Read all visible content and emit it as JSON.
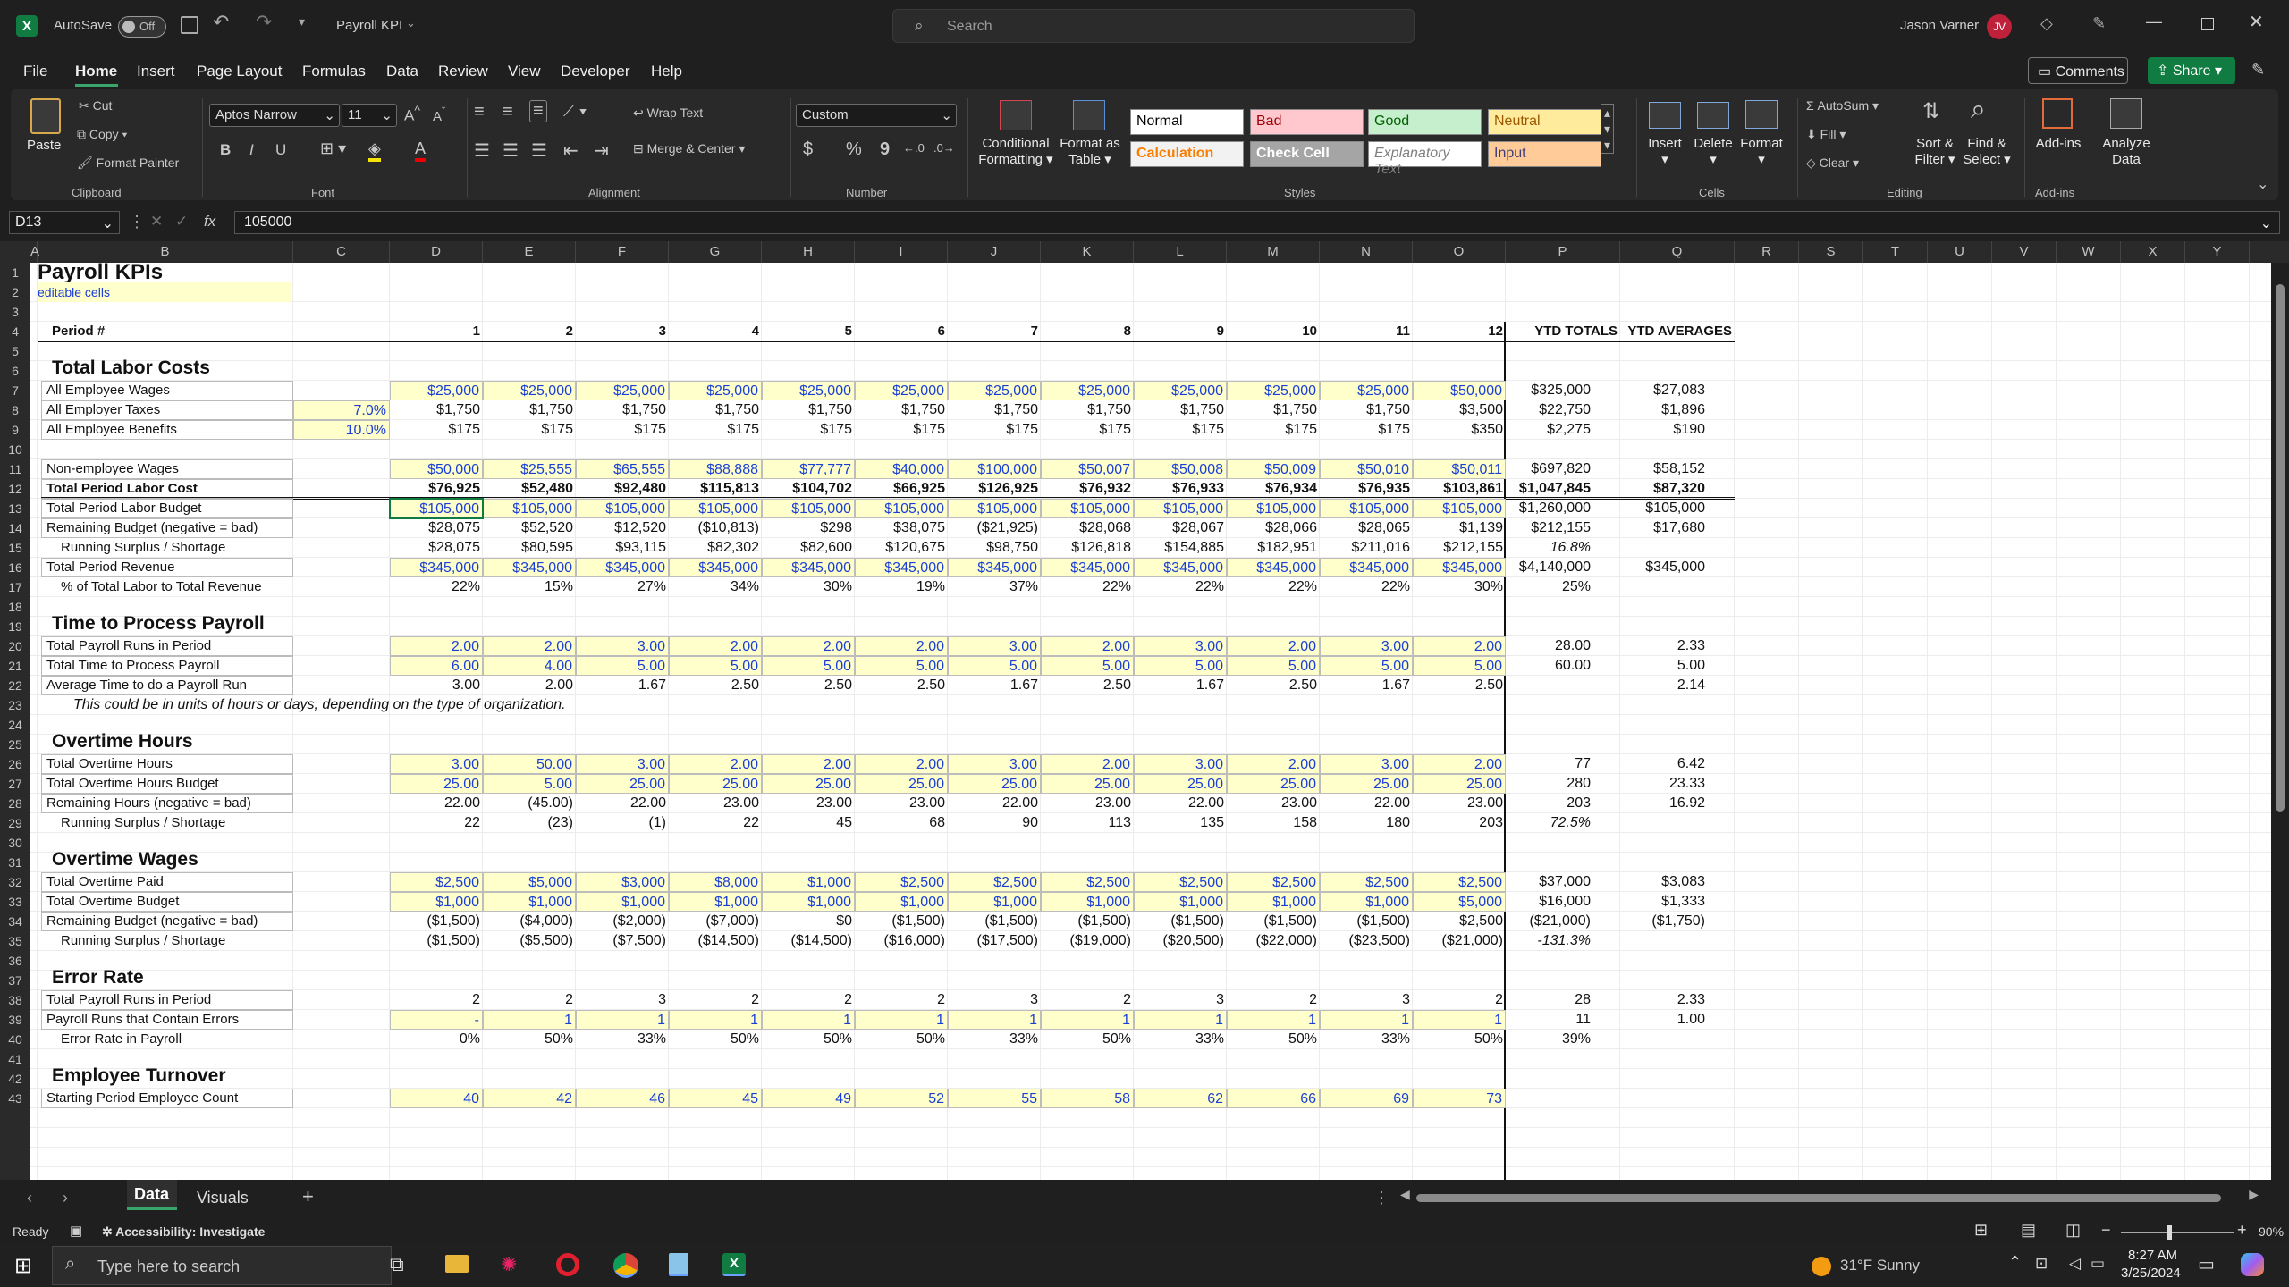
{
  "titlebar": {
    "autosave": "AutoSave",
    "autosave_state": "Off",
    "doc_title": "Payroll KPI",
    "search_placeholder": "Search",
    "user_name": "Jason Varner",
    "user_initials": "JV"
  },
  "menu": [
    "File",
    "Home",
    "Insert",
    "Page Layout",
    "Formulas",
    "Data",
    "Review",
    "View",
    "Developer",
    "Help"
  ],
  "menu_right": {
    "comments": "Comments",
    "share": "Share"
  },
  "ribbon": {
    "clipboard": {
      "paste": "Paste",
      "cut": "Cut",
      "copy": "Copy",
      "format_painter": "Format Painter",
      "group": "Clipboard"
    },
    "font": {
      "name": "Aptos Narrow",
      "size": "11",
      "bold": "B",
      "italic": "I",
      "underline": "U",
      "group": "Font"
    },
    "alignment": {
      "wrap": "Wrap Text",
      "merge": "Merge & Center",
      "group": "Alignment"
    },
    "number": {
      "format": "Custom",
      "dollar": "$",
      "percent": "%",
      "comma": "9",
      "group": "Number"
    },
    "styles": {
      "cond_1": "Conditional",
      "cond_2": "Formatting",
      "table_1": "Format as",
      "table_2": "Table",
      "tiles": [
        {
          "label": "Normal",
          "bg": "#ffffff",
          "fg": "#000000"
        },
        {
          "label": "Bad",
          "bg": "#ffc7ce",
          "fg": "#9c0006"
        },
        {
          "label": "Good",
          "bg": "#c6efce",
          "fg": "#006100"
        },
        {
          "label": "Neutral",
          "bg": "#ffeb9c",
          "fg": "#9c5700"
        },
        {
          "label": "Calculation",
          "bg": "#f2f2f2",
          "fg": "#fa7d00"
        },
        {
          "label": "Check Cell",
          "bg": "#a5a5a5",
          "fg": "#ffffff"
        },
        {
          "label": "Explanatory Text",
          "bg": "#ffffff",
          "fg": "#7f7f7f"
        },
        {
          "label": "Input",
          "bg": "#ffcc99",
          "fg": "#3f3f76"
        }
      ],
      "group": "Styles"
    },
    "cells": {
      "insert": "Insert",
      "delete": "Delete",
      "format": "Format",
      "group": "Cells"
    },
    "editing": {
      "autosum": "AutoSum",
      "fill": "Fill",
      "clear": "Clear",
      "sort_1": "Sort &",
      "sort_2": "Filter",
      "find_1": "Find &",
      "find_2": "Select",
      "group": "Editing"
    },
    "addins": {
      "addins": "Add-ins",
      "analyze_1": "Analyze",
      "analyze_2": "Data",
      "group": "Add-ins"
    }
  },
  "formula_bar": {
    "name_box": "D13",
    "fx": "fx",
    "value": "105000"
  },
  "columns": [
    "A",
    "B",
    "C",
    "D",
    "E",
    "F",
    "G",
    "H",
    "I",
    "J",
    "K",
    "L",
    "M",
    "N",
    "O",
    "P",
    "Q",
    "R",
    "S",
    "T",
    "U",
    "V",
    "W",
    "X",
    "Y"
  ],
  "rows": [
    "1",
    "2",
    "3",
    "4",
    "5",
    "6",
    "7",
    "8",
    "9",
    "10",
    "11",
    "12",
    "13",
    "14",
    "15",
    "16",
    "17",
    "18",
    "19",
    "20",
    "21",
    "22",
    "23",
    "24",
    "25",
    "26",
    "27",
    "28",
    "29",
    "30",
    "31",
    "32",
    "33",
    "34",
    "35",
    "36",
    "37",
    "38",
    "39",
    "40",
    "41",
    "42",
    "43"
  ],
  "sheet": {
    "title": "Payroll KPIs",
    "editable": "editable cells",
    "period_label": "Period #",
    "periods": [
      "1",
      "2",
      "3",
      "4",
      "5",
      "6",
      "7",
      "8",
      "9",
      "10",
      "11",
      "12"
    ],
    "ytd_totals": "YTD TOTALS",
    "ytd_avg": "YTD AVERAGES",
    "sections": [
      {
        "row": 6,
        "title": "Total Labor Costs"
      },
      {
        "row": 19,
        "title": "Time to Process Payroll"
      },
      {
        "row": 25,
        "title": "Overtime Hours"
      },
      {
        "row": 31,
        "title": "Overtime Wages"
      },
      {
        "row": 37,
        "title": "Error Rate"
      },
      {
        "row": 42,
        "title": "Employee Turnover"
      }
    ],
    "note": "This could be in units of hours or days, depending on the type of organization.",
    "lines": [
      {
        "row": 7,
        "label": "All Employee Wages",
        "indent": 0,
        "c": "",
        "edit": true,
        "blue": true,
        "vals": [
          "$25,000",
          "$25,000",
          "$25,000",
          "$25,000",
          "$25,000",
          "$25,000",
          "$25,000",
          "$25,000",
          "$25,000",
          "$25,000",
          "$25,000",
          "$50,000"
        ],
        "p": "$325,000",
        "q": "$27,083"
      },
      {
        "row": 8,
        "label": "All Employer Taxes",
        "indent": 0,
        "c": "7.0%",
        "vals": [
          "$1,750",
          "$1,750",
          "$1,750",
          "$1,750",
          "$1,750",
          "$1,750",
          "$1,750",
          "$1,750",
          "$1,750",
          "$1,750",
          "$1,750",
          "$3,500"
        ],
        "p": "$22,750",
        "q": "$1,896"
      },
      {
        "row": 9,
        "label": "All Employee Benefits",
        "indent": 0,
        "c": "10.0%",
        "vals": [
          "$175",
          "$175",
          "$175",
          "$175",
          "$175",
          "$175",
          "$175",
          "$175",
          "$175",
          "$175",
          "$175",
          "$350"
        ],
        "p": "$2,275",
        "q": "$190"
      },
      {
        "row": 11,
        "label": "Non-employee Wages",
        "indent": 0,
        "c": "",
        "edit": true,
        "blue": true,
        "vals": [
          "$50,000",
          "$25,555",
          "$65,555",
          "$88,888",
          "$77,777",
          "$40,000",
          "$100,000",
          "$50,007",
          "$50,008",
          "$50,009",
          "$50,010",
          "$50,011"
        ],
        "p": "$697,820",
        "q": "$58,152"
      },
      {
        "row": 12,
        "label": "Total Period Labor Cost",
        "indent": 0,
        "bold": true,
        "c": "",
        "vals": [
          "$76,925",
          "$52,480",
          "$92,480",
          "$115,813",
          "$104,702",
          "$66,925",
          "$126,925",
          "$76,932",
          "$76,933",
          "$76,934",
          "$76,935",
          "$103,861"
        ],
        "p": "$1,047,845",
        "q": "$87,320"
      },
      {
        "row": 13,
        "label": "Total Period Labor Budget",
        "indent": 0,
        "c": "",
        "edit": true,
        "blue": true,
        "vals": [
          "$105,000",
          "$105,000",
          "$105,000",
          "$105,000",
          "$105,000",
          "$105,000",
          "$105,000",
          "$105,000",
          "$105,000",
          "$105,000",
          "$105,000",
          "$105,000"
        ],
        "p": "$1,260,000",
        "q": "$105,000"
      },
      {
        "row": 14,
        "label": "Remaining Budget (negative = bad)",
        "indent": 0,
        "c": "",
        "vals": [
          "$28,075",
          "$52,520",
          "$12,520",
          "($10,813)",
          "$298",
          "$38,075",
          "($21,925)",
          "$28,068",
          "$28,067",
          "$28,066",
          "$28,065",
          "$1,139"
        ],
        "p": "$212,155",
        "q": "$17,680"
      },
      {
        "row": 15,
        "label": "Running Surplus / Shortage",
        "indent": 1,
        "c": "",
        "vals": [
          "$28,075",
          "$80,595",
          "$93,115",
          "$82,302",
          "$82,600",
          "$120,675",
          "$98,750",
          "$126,818",
          "$154,885",
          "$182,951",
          "$211,016",
          "$212,155"
        ],
        "p": "16.8%",
        "pital": true,
        "q": ""
      },
      {
        "row": 16,
        "label": "Total Period Revenue",
        "indent": 0,
        "c": "",
        "edit": true,
        "blue": true,
        "vals": [
          "$345,000",
          "$345,000",
          "$345,000",
          "$345,000",
          "$345,000",
          "$345,000",
          "$345,000",
          "$345,000",
          "$345,000",
          "$345,000",
          "$345,000",
          "$345,000"
        ],
        "p": "$4,140,000",
        "q": "$345,000"
      },
      {
        "row": 17,
        "label": "% of Total Labor to Total Revenue",
        "indent": 1,
        "c": "",
        "vals": [
          "22%",
          "15%",
          "27%",
          "34%",
          "30%",
          "19%",
          "37%",
          "22%",
          "22%",
          "22%",
          "22%",
          "30%"
        ],
        "p": "25%",
        "q": ""
      },
      {
        "row": 20,
        "label": "Total Payroll Runs in Period",
        "indent": 0,
        "c": "",
        "edit": true,
        "blue": true,
        "vals": [
          "2.00",
          "2.00",
          "3.00",
          "2.00",
          "2.00",
          "2.00",
          "3.00",
          "2.00",
          "3.00",
          "2.00",
          "3.00",
          "2.00"
        ],
        "p": "28.00",
        "q": "2.33"
      },
      {
        "row": 21,
        "label": "Total Time to Process Payroll",
        "indent": 0,
        "c": "",
        "edit": true,
        "blue": true,
        "vals": [
          "6.00",
          "4.00",
          "5.00",
          "5.00",
          "5.00",
          "5.00",
          "5.00",
          "5.00",
          "5.00",
          "5.00",
          "5.00",
          "5.00"
        ],
        "p": "60.00",
        "q": "5.00"
      },
      {
        "row": 22,
        "label": "Average Time to do a Payroll Run",
        "indent": 0,
        "c": "",
        "vals": [
          "3.00",
          "2.00",
          "1.67",
          "2.50",
          "2.50",
          "2.50",
          "1.67",
          "2.50",
          "1.67",
          "2.50",
          "1.67",
          "2.50"
        ],
        "p": "",
        "q": "2.14"
      },
      {
        "row": 26,
        "label": "Total Overtime Hours",
        "indent": 0,
        "c": "",
        "edit": true,
        "blue": true,
        "vals": [
          "3.00",
          "50.00",
          "3.00",
          "2.00",
          "2.00",
          "2.00",
          "3.00",
          "2.00",
          "3.00",
          "2.00",
          "3.00",
          "2.00"
        ],
        "p": "77",
        "q": "6.42"
      },
      {
        "row": 27,
        "label": "Total Overtime Hours Budget",
        "indent": 0,
        "c": "",
        "edit": true,
        "blue": true,
        "vals": [
          "25.00",
          "5.00",
          "25.00",
          "25.00",
          "25.00",
          "25.00",
          "25.00",
          "25.00",
          "25.00",
          "25.00",
          "25.00",
          "25.00"
        ],
        "p": "280",
        "q": "23.33"
      },
      {
        "row": 28,
        "label": "Remaining Hours (negative = bad)",
        "indent": 0,
        "c": "",
        "vals": [
          "22.00",
          "(45.00)",
          "22.00",
          "23.00",
          "23.00",
          "23.00",
          "22.00",
          "23.00",
          "22.00",
          "23.00",
          "22.00",
          "23.00"
        ],
        "p": "203",
        "q": "16.92"
      },
      {
        "row": 29,
        "label": "Running Surplus / Shortage",
        "indent": 1,
        "c": "",
        "vals": [
          "22",
          "(23)",
          "(1)",
          "22",
          "45",
          "68",
          "90",
          "113",
          "135",
          "158",
          "180",
          "203"
        ],
        "p": "72.5%",
        "pital": true,
        "q": ""
      },
      {
        "row": 32,
        "label": "Total Overtime Paid",
        "indent": 0,
        "c": "",
        "edit": true,
        "blue": true,
        "vals": [
          "$2,500",
          "$5,000",
          "$3,000",
          "$8,000",
          "$1,000",
          "$2,500",
          "$2,500",
          "$2,500",
          "$2,500",
          "$2,500",
          "$2,500",
          "$2,500"
        ],
        "p": "$37,000",
        "q": "$3,083"
      },
      {
        "row": 33,
        "label": "Total Overtime Budget",
        "indent": 0,
        "c": "",
        "edit": true,
        "blue": true,
        "vals": [
          "$1,000",
          "$1,000",
          "$1,000",
          "$1,000",
          "$1,000",
          "$1,000",
          "$1,000",
          "$1,000",
          "$1,000",
          "$1,000",
          "$1,000",
          "$5,000"
        ],
        "p": "$16,000",
        "q": "$1,333"
      },
      {
        "row": 34,
        "label": "Remaining Budget (negative = bad)",
        "indent": 0,
        "c": "",
        "vals": [
          "($1,500)",
          "($4,000)",
          "($2,000)",
          "($7,000)",
          "$0",
          "($1,500)",
          "($1,500)",
          "($1,500)",
          "($1,500)",
          "($1,500)",
          "($1,500)",
          "$2,500"
        ],
        "p": "($21,000)",
        "q": "($1,750)"
      },
      {
        "row": 35,
        "label": "Running Surplus / Shortage",
        "indent": 1,
        "c": "",
        "vals": [
          "($1,500)",
          "($5,500)",
          "($7,500)",
          "($14,500)",
          "($14,500)",
          "($16,000)",
          "($17,500)",
          "($19,000)",
          "($20,500)",
          "($22,000)",
          "($23,500)",
          "($21,000)"
        ],
        "p": "-131.3%",
        "pital": true,
        "q": ""
      },
      {
        "row": 38,
        "label": "Total Payroll Runs in Period",
        "indent": 0,
        "c": "",
        "vals": [
          "2",
          "2",
          "3",
          "2",
          "2",
          "2",
          "3",
          "2",
          "3",
          "2",
          "3",
          "2"
        ],
        "p": "28",
        "q": "2.33"
      },
      {
        "row": 39,
        "label": "Payroll Runs that Contain Errors",
        "indent": 0,
        "c": "",
        "edit": true,
        "blue": true,
        "vals": [
          "-",
          "1",
          "1",
          "1",
          "1",
          "1",
          "1",
          "1",
          "1",
          "1",
          "1",
          "1"
        ],
        "p": "11",
        "q": "1.00"
      },
      {
        "row": 40,
        "label": "Error Rate in Payroll",
        "indent": 1,
        "c": "",
        "vals": [
          "0%",
          "50%",
          "33%",
          "50%",
          "50%",
          "50%",
          "33%",
          "50%",
          "33%",
          "50%",
          "33%",
          "50%"
        ],
        "p": "39%",
        "q": ""
      },
      {
        "row": 43,
        "label": "Starting Period Employee Count",
        "indent": 0,
        "c": "",
        "edit": true,
        "blue": true,
        "vals": [
          "40",
          "42",
          "46",
          "45",
          "49",
          "52",
          "55",
          "58",
          "62",
          "66",
          "69",
          "73"
        ],
        "p": "",
        "q": ""
      }
    ]
  },
  "tabs": {
    "data": "Data",
    "visuals": "Visuals",
    "add": "+"
  },
  "status": {
    "ready": "Ready",
    "accessibility": "Accessibility: Investigate",
    "zoom": "90%"
  },
  "taskbar": {
    "search": "Type here to search",
    "weather": "31°F  Sunny",
    "time": "8:27 AM",
    "date": "3/25/2024"
  }
}
